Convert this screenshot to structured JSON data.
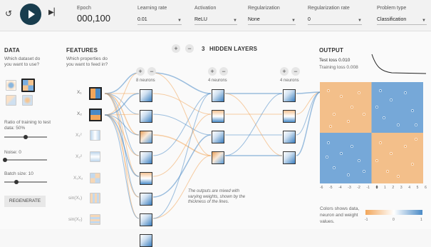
{
  "controls": {
    "epoch_label": "Epoch",
    "epoch_value": "000,100",
    "lr_label": "Learning rate",
    "lr_value": "0.01",
    "act_label": "Activation",
    "act_value": "ReLU",
    "reg_label": "Regularization",
    "reg_value": "None",
    "regrate_label": "Regularization rate",
    "regrate_value": "0",
    "ptype_label": "Problem type",
    "ptype_value": "Classification"
  },
  "data": {
    "title": "DATA",
    "q": "Which dataset do you want to use?",
    "ratio": "Ratio of training to test data:  50%",
    "ratio_level": 0.5,
    "noise": "Noise:  0",
    "noise_level": 0,
    "batch": "Batch size:  10",
    "batch_level": 0.3,
    "regen": "REGENERATE"
  },
  "features": {
    "title": "FEATURES",
    "q": "Which properties do you want to feed in?",
    "names": [
      "X₁",
      "X₂",
      "X₁²",
      "X₂²",
      "X₁X₂",
      "sin(X₁)",
      "sin(X₂)"
    ]
  },
  "layers": {
    "title": "HIDDEN LAYERS",
    "count": "3",
    "neurons": [
      "8 neurons",
      "4 neurons",
      "4 neurons"
    ]
  },
  "note": {
    "text": "The outputs are mixed with varying weights, shown by the thickness of the lines."
  },
  "output": {
    "title": "OUTPUT",
    "test": "Test loss 0.010",
    "train": "Training loss 0.008",
    "axis": [
      "-6",
      "-5",
      "-4",
      "-3",
      "-2",
      "-1",
      "0",
      "1",
      "2",
      "3",
      "4",
      "5",
      "6"
    ],
    "legend_text": "Colors shows data, neuron and weight values.",
    "legend_ticks": [
      "-1",
      "0",
      "1"
    ]
  },
  "colors": {
    "orange": "#f2a65a",
    "blue": "#4a8ac6"
  }
}
